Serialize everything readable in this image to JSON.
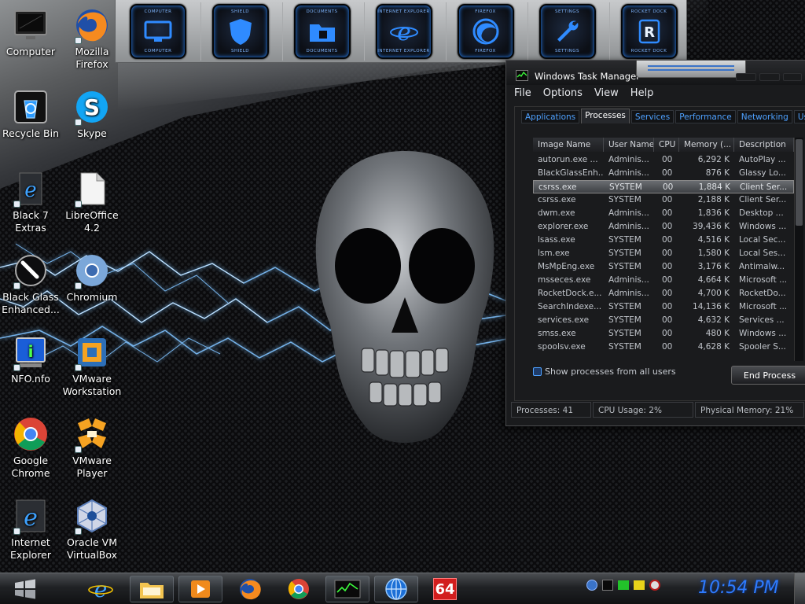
{
  "desktop_icons": [
    {
      "id": "computer",
      "label": "Computer",
      "icon": "monitor-icon"
    },
    {
      "id": "recycle-bin",
      "label": "Recycle Bin",
      "icon": "recycle-bin-icon"
    },
    {
      "id": "black7-extras",
      "label": "Black 7 Extras",
      "icon": "ie-icon"
    },
    {
      "id": "black-glass",
      "label": "Black Glass Enhanced...",
      "icon": "brush-icon"
    },
    {
      "id": "nfo",
      "label": "NFO.nfo",
      "icon": "info-icon"
    },
    {
      "id": "google-chrome",
      "label": "Google Chrome",
      "icon": "chrome-icon"
    },
    {
      "id": "internet-explorer",
      "label": "Internet Explorer",
      "icon": "ie-icon"
    },
    {
      "id": "mozilla-firefox",
      "label": "Mozilla Firefox",
      "icon": "firefox-icon"
    },
    {
      "id": "skype",
      "label": "Skype",
      "icon": "skype-icon"
    },
    {
      "id": "libreoffice",
      "label": "LibreOffice 4.2",
      "icon": "document-icon"
    },
    {
      "id": "chromium",
      "label": "Chromium",
      "icon": "chromium-icon"
    },
    {
      "id": "vmware-workstation",
      "label": "VMware Workstation",
      "icon": "vmware-icon"
    },
    {
      "id": "vmware-player",
      "label": "VMware Player",
      "icon": "vmware-player-icon"
    },
    {
      "id": "virtualbox",
      "label": "Oracle VM VirtualBox",
      "icon": "virtualbox-icon"
    }
  ],
  "dock": [
    {
      "label": "COMPUTER",
      "icon": "monitor-icon"
    },
    {
      "label": "SHIELD",
      "icon": "shield-icon"
    },
    {
      "label": "DOCUMENTS",
      "icon": "folder-icon"
    },
    {
      "label": "INTERNET EXPLORER",
      "icon": "ie-icon"
    },
    {
      "label": "FIREFOX",
      "icon": "firefox-icon"
    },
    {
      "label": "SETTINGS",
      "icon": "wrench-icon"
    },
    {
      "label": "ROCKET DOCK",
      "icon": "rocketdock-icon"
    }
  ],
  "task_manager": {
    "title": "Windows Task Manager",
    "menu": [
      "File",
      "Options",
      "View",
      "Help"
    ],
    "tabs": [
      "Applications",
      "Processes",
      "Services",
      "Performance",
      "Networking",
      "Users"
    ],
    "active_tab": "Processes",
    "columns": [
      "Image Name",
      "User Name",
      "CPU",
      "Memory (...",
      "Description"
    ],
    "processes": [
      [
        "autorun.exe ...",
        "Adminis...",
        "00",
        "6,292 K",
        "AutoPlay ..."
      ],
      [
        "BlackGlassEnh...",
        "Adminis...",
        "00",
        "876 K",
        "Glassy Lo..."
      ],
      [
        "csrss.exe",
        "SYSTEM",
        "00",
        "1,884 K",
        "Client Ser..."
      ],
      [
        "csrss.exe",
        "SYSTEM",
        "00",
        "2,188 K",
        "Client Ser..."
      ],
      [
        "dwm.exe",
        "Adminis...",
        "00",
        "1,836 K",
        "Desktop ..."
      ],
      [
        "explorer.exe",
        "Adminis...",
        "00",
        "39,436 K",
        "Windows ..."
      ],
      [
        "lsass.exe",
        "SYSTEM",
        "00",
        "4,516 K",
        "Local Sec..."
      ],
      [
        "lsm.exe",
        "SYSTEM",
        "00",
        "1,580 K",
        "Local Ses..."
      ],
      [
        "MsMpEng.exe",
        "SYSTEM",
        "00",
        "3,176 K",
        "Antimalw..."
      ],
      [
        "msseces.exe",
        "Adminis...",
        "00",
        "4,664 K",
        "Microsoft ..."
      ],
      [
        "RocketDock.e...",
        "Adminis...",
        "00",
        "4,700 K",
        "RocketDo..."
      ],
      [
        "SearchIndexe...",
        "SYSTEM",
        "00",
        "14,136 K",
        "Microsoft ..."
      ],
      [
        "services.exe",
        "SYSTEM",
        "00",
        "4,632 K",
        "Services ..."
      ],
      [
        "smss.exe",
        "SYSTEM",
        "00",
        "480 K",
        "Windows ..."
      ],
      [
        "spoolsv.exe",
        "SYSTEM",
        "00",
        "4,628 K",
        "Spooler S..."
      ]
    ],
    "selected_row": 2,
    "show_all_label": "Show processes from all users",
    "end_process_label": "End Process",
    "status": {
      "processes": "Processes: 41",
      "cpu": "CPU Usage: 2%",
      "memory": "Physical Memory: 21%"
    }
  },
  "taskbar": {
    "pinned": [
      {
        "name": "ie-icon"
      },
      {
        "name": "explorer-folder-icon"
      },
      {
        "name": "media-player-icon"
      },
      {
        "name": "firefox-icon"
      },
      {
        "name": "chrome-icon"
      },
      {
        "name": "task-manager-icon"
      },
      {
        "name": "globe-icon"
      },
      {
        "name": "win64-badge-icon",
        "text": "64"
      }
    ],
    "clock": "10:54 PM"
  },
  "colors": {
    "accent_blue": "#2e7bff",
    "tab_text": "#4ea1ff",
    "panel_bg": "#1a1b1d"
  }
}
